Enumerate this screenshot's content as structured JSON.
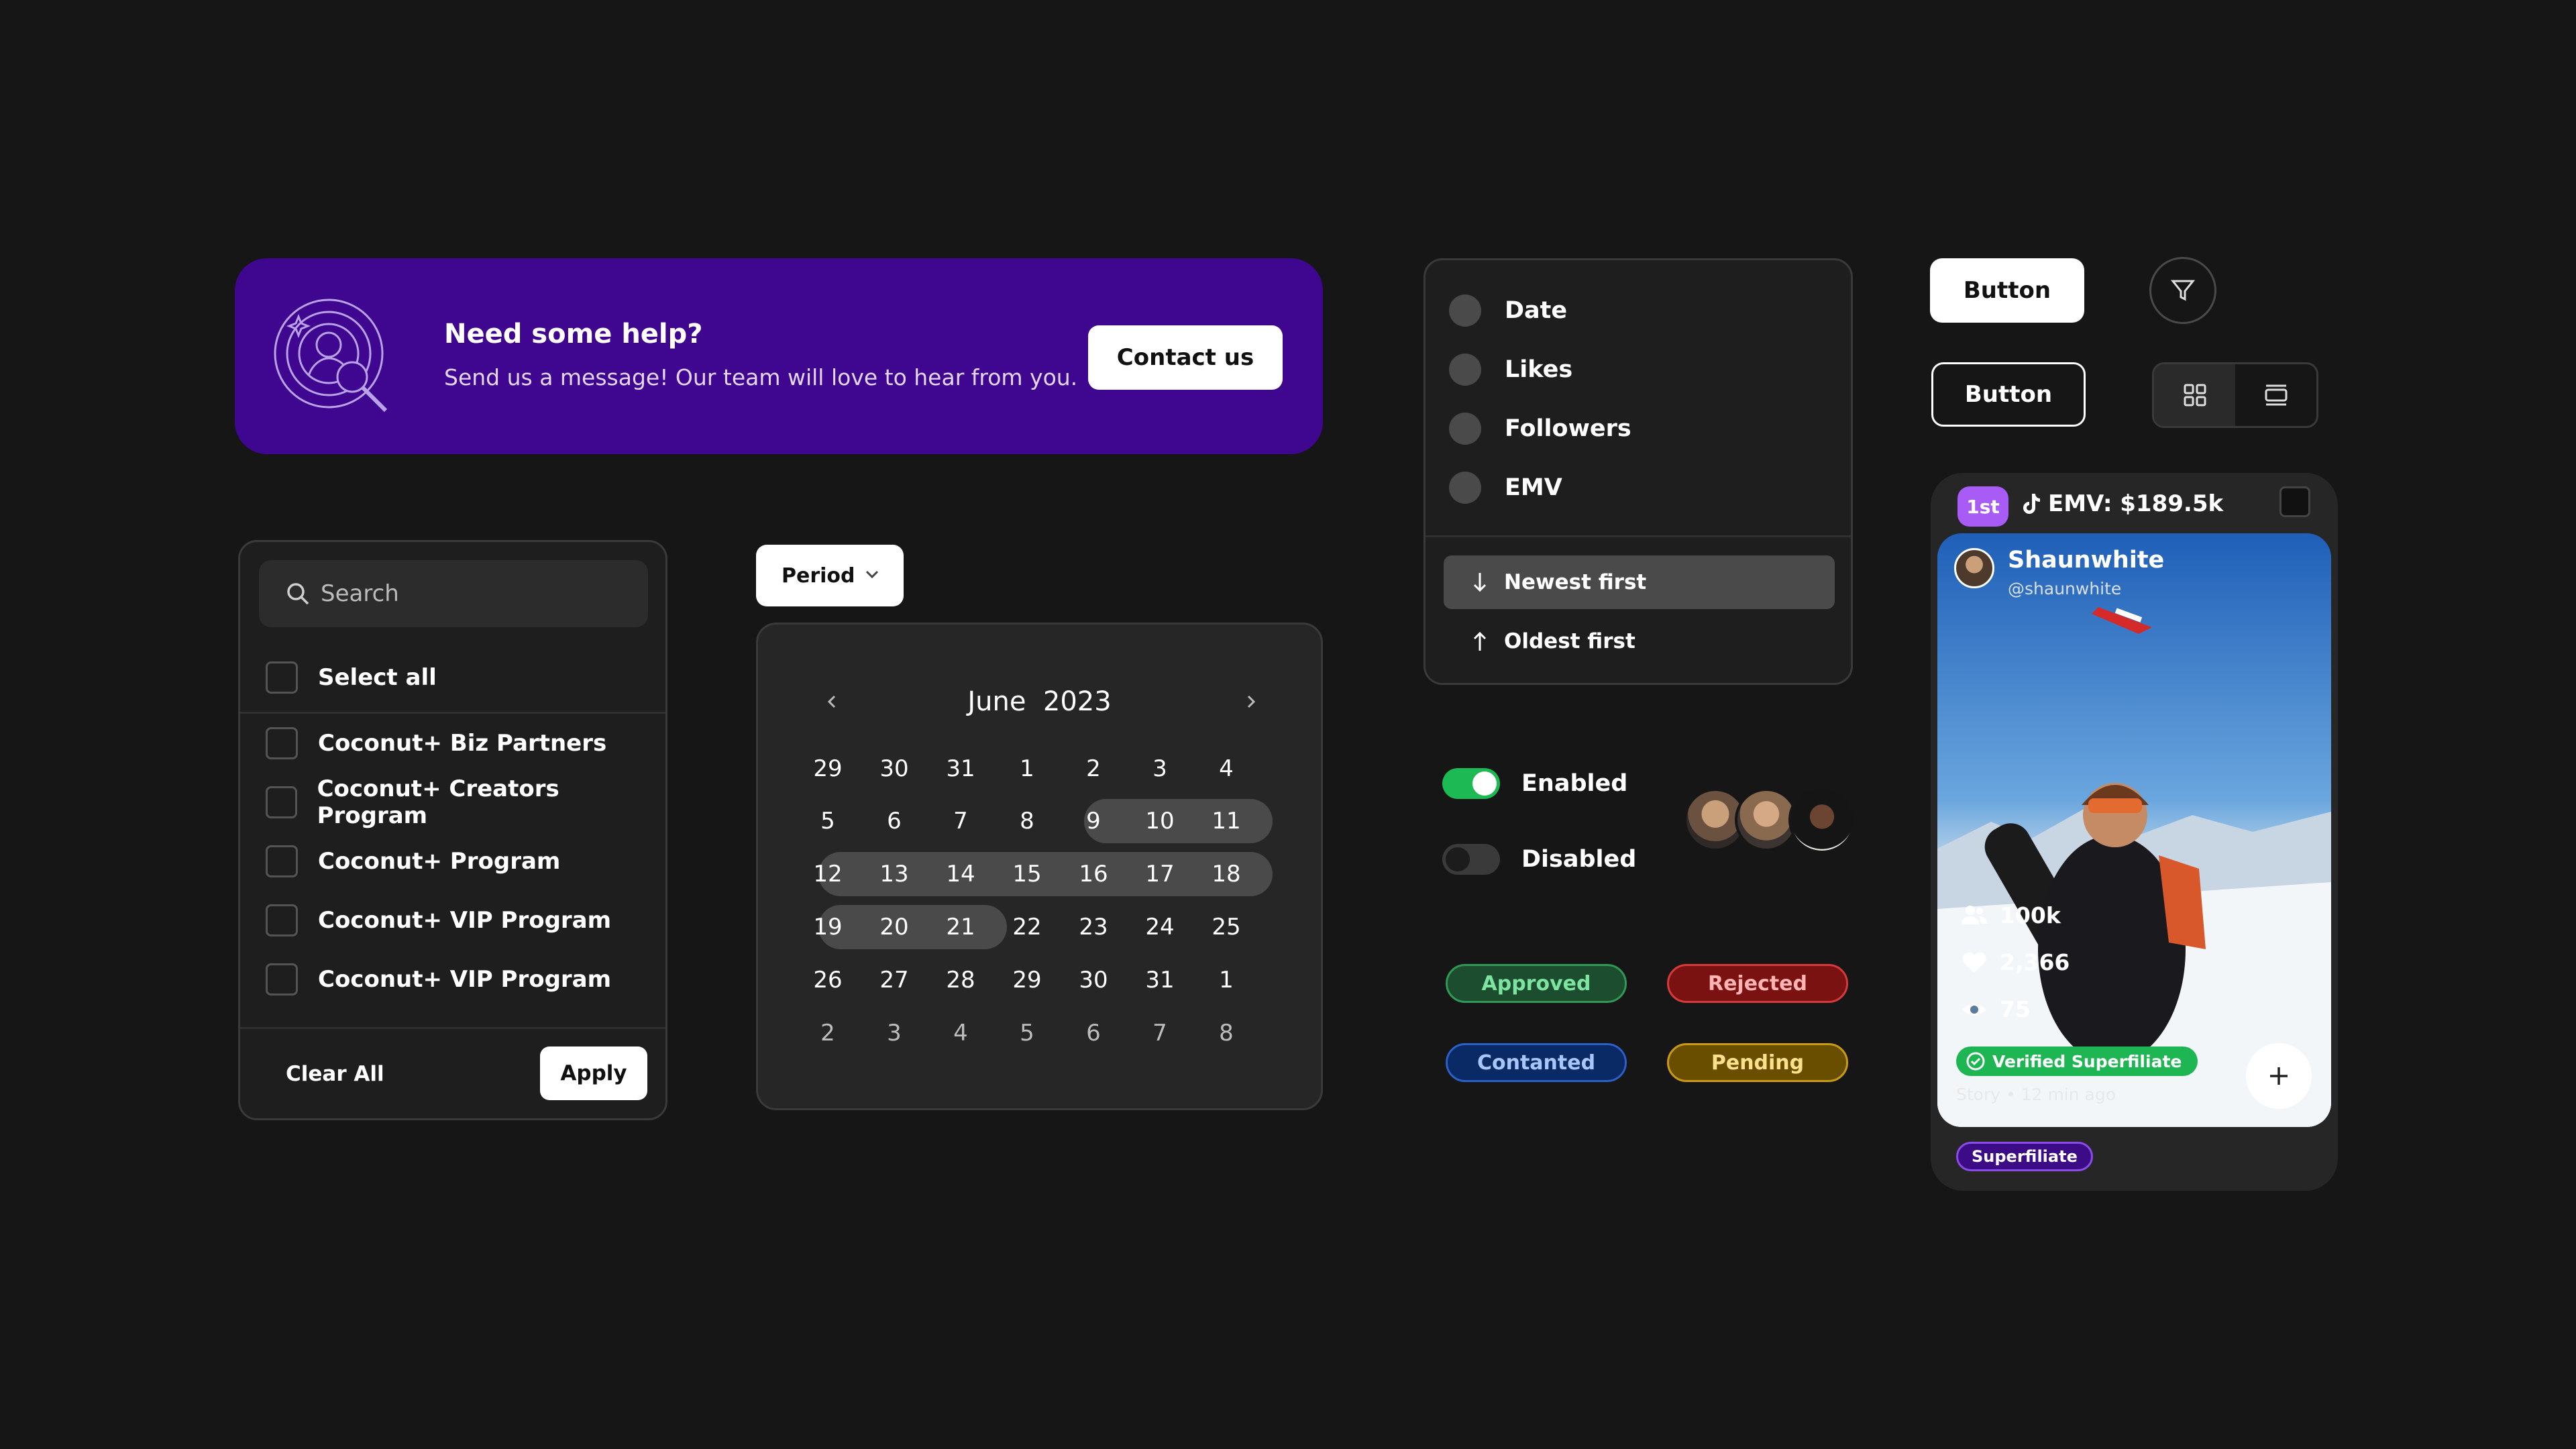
{
  "help_banner": {
    "title": "Need some help?",
    "subtitle": "Send us a message! Our team will love to hear from you.",
    "contact_label": "Contact us",
    "icon": "support-search-icon",
    "bg_color": "#3f0790"
  },
  "filter_list": {
    "search_placeholder": "Search",
    "select_all": "Select all",
    "items": [
      "Coconut+ Biz Partners",
      "Coconut+ Creators Program",
      "Coconut+ Program",
      "Coconut+ VIP Program",
      "Coconut+ VIP Program"
    ],
    "clear_label": "Clear All",
    "apply_label": "Apply"
  },
  "period": {
    "label": "Period",
    "icon": "chevron-down-icon"
  },
  "calendar": {
    "month": "June",
    "year": "2023",
    "weeks": [
      [
        "29",
        "30",
        "31",
        "1",
        "2",
        "3",
        "4"
      ],
      [
        "5",
        "6",
        "7",
        "8",
        "9",
        "10",
        "11"
      ],
      [
        "12",
        "13",
        "14",
        "15",
        "16",
        "17",
        "18"
      ],
      [
        "19",
        "20",
        "21",
        "22",
        "23",
        "24",
        "25"
      ],
      [
        "26",
        "27",
        "28",
        "29",
        "30",
        "31",
        "1"
      ],
      [
        "2",
        "3",
        "4",
        "5",
        "6",
        "7",
        "8"
      ]
    ],
    "selected_range": "9 – 21"
  },
  "sort_panel": {
    "options": [
      "Date",
      "Likes",
      "Followers",
      "EMV"
    ],
    "orders": [
      "Newest first",
      "Oldest first"
    ],
    "active_order": "Newest first"
  },
  "toggles": {
    "enabled_label": "Enabled",
    "disabled_label": "Disabled",
    "on_color": "#1db954"
  },
  "status_chips": {
    "approved": "Approved",
    "rejected": "Rejected",
    "contacted": "Contanted",
    "pending": "Pending",
    "colors": {
      "approved": "#1d4d2f",
      "rejected": "#7a1212",
      "contacted": "#0a2a66",
      "pending": "#6a4e00"
    }
  },
  "buttons": {
    "solid_label": "Button",
    "outline_label": "Button",
    "filter_icon": "funnel-icon",
    "grid_icon": "grid-view-icon",
    "list_icon": "list-view-icon"
  },
  "creator_card": {
    "rank": "1st",
    "emv": "EMV: $189.5k",
    "platform_icon": "tiktok-icon",
    "username": "Shaunwhite",
    "handle": "@shaunwhite",
    "followers": "100k",
    "likes": "2,366",
    "views": "75",
    "verified_label": "Verified Superfiliate",
    "story_meta": "Story • 12 min ago",
    "tag": "Superfiliate",
    "accent": "#a85cf5"
  }
}
